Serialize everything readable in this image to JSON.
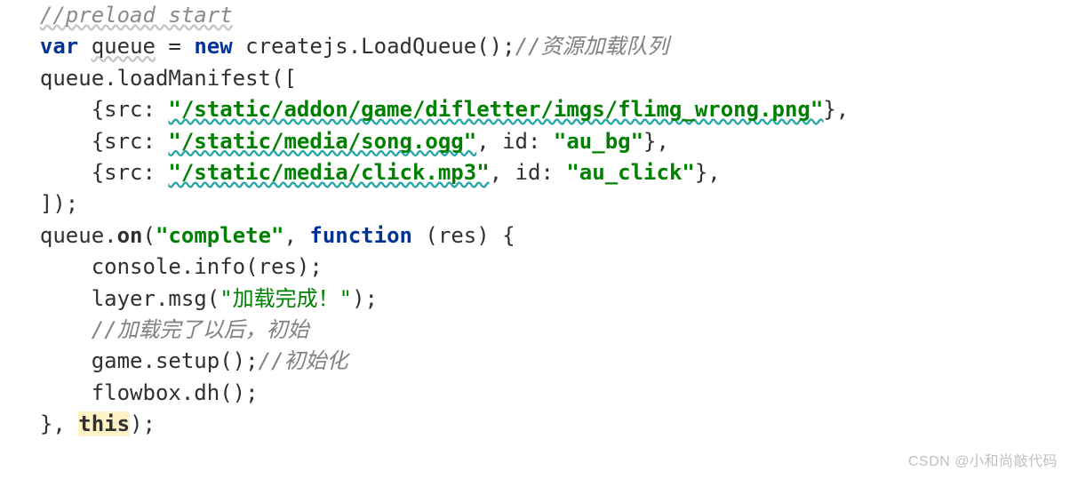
{
  "code": {
    "line1": {
      "comment": "//preload start"
    },
    "line2": {
      "kw_var": "var",
      "sp1": " ",
      "queue": "queue",
      "sp2": " = ",
      "kw_new": "new",
      "sp3": " ",
      "call": "createjs.LoadQueue();",
      "comment": "//资源加载队列"
    },
    "line3": {
      "text": "queue.loadManifest(["
    },
    "line4": {
      "open": "    {src: ",
      "str": "\"/static/addon/game/difletter/imgs/flimg_wrong.png\"",
      "close": "},"
    },
    "line5": {
      "open": "    {src: ",
      "str1": "\"/static/media/song.ogg\"",
      "mid": ", id: ",
      "str2": "\"au_bg\"",
      "close": "},"
    },
    "line6": {
      "open": "    {src: ",
      "str1": "\"/static/media/click.mp3\"",
      "mid": ", id: ",
      "str2": "\"au_click\"",
      "close": "},"
    },
    "line7": {
      "text": "]);"
    },
    "line8": {
      "a": "queue.",
      "on": "on",
      "b": "(",
      "str": "\"complete\"",
      "c": ", ",
      "kw_fn": "function",
      "d": " (res) {"
    },
    "line9": {
      "text": "    console.info(res);"
    },
    "line10": {
      "a": "    layer.msg(",
      "str": "\"加载完成！\"",
      "b": ");"
    },
    "line11": {
      "comment": "    //加载完了以后，初始"
    },
    "line12": {
      "a": "    game.setup();",
      "comment": "//初始化"
    },
    "line13": {
      "text": "    flowbox.dh();"
    },
    "line14": {
      "a": "}, ",
      "this": "this",
      "b": ");"
    }
  },
  "watermark": "CSDN @小和尚敲代码"
}
